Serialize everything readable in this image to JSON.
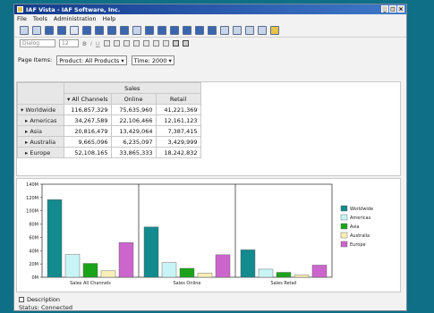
{
  "window": {
    "title": "IAF Vista - IAF Software, Inc.",
    "controls": [
      "_",
      "□",
      "×"
    ]
  },
  "menu": [
    "File",
    "Tools",
    "Administration",
    "Help"
  ],
  "toolbar": {
    "style_field": "Dialog",
    "size_field": "12",
    "format_buttons": [
      "B",
      "I",
      "U"
    ]
  },
  "page_items": {
    "label": "Page Items:",
    "product": "Product: All Products",
    "time": "Time: 2000"
  },
  "crosstab": {
    "measure": "Sales",
    "columns": [
      "All Channels",
      "Online",
      "Retail"
    ],
    "rows": [
      {
        "label": "Worldwide",
        "values": [
          "116,857,329",
          "75,635,960",
          "41,221,369"
        ]
      },
      {
        "label": "Americas",
        "values": [
          "34,267,589",
          "22,106,466",
          "12,161,123"
        ]
      },
      {
        "label": "Asia",
        "values": [
          "20,816,479",
          "13,429,064",
          "7,387,415"
        ]
      },
      {
        "label": "Australia",
        "values": [
          "9,665,096",
          "6,235,097",
          "3,429,999"
        ]
      },
      {
        "label": "Europe",
        "values": [
          "52,108,165",
          "33,865,333",
          "18,242,832"
        ]
      }
    ]
  },
  "chart_data": {
    "type": "bar",
    "categories": [
      "Sales All Channels",
      "Sales Online",
      "Sales Retail"
    ],
    "series": [
      {
        "name": "Worldwide",
        "values": [
          116857329,
          75635960,
          41221369
        ],
        "color": "#138a8e"
      },
      {
        "name": "Americas",
        "values": [
          34267589,
          22106466,
          12161123
        ],
        "color": "#c9f4f6"
      },
      {
        "name": "Asia",
        "values": [
          20816479,
          13429064,
          7387415
        ],
        "color": "#1aa31a"
      },
      {
        "name": "Australia",
        "values": [
          9665096,
          6235097,
          3429999
        ],
        "color": "#f8f0b8"
      },
      {
        "name": "Europe",
        "values": [
          52108165,
          33865333,
          18242832
        ],
        "color": "#cc66cc"
      }
    ],
    "ylim": [
      0,
      140000000
    ],
    "yticks": [
      "0M",
      "20M",
      "40M",
      "60M",
      "80M",
      "100M",
      "120M",
      "140M"
    ],
    "legend": "right",
    "grid": false
  },
  "description_label": "Description",
  "status": "Status: Connected"
}
